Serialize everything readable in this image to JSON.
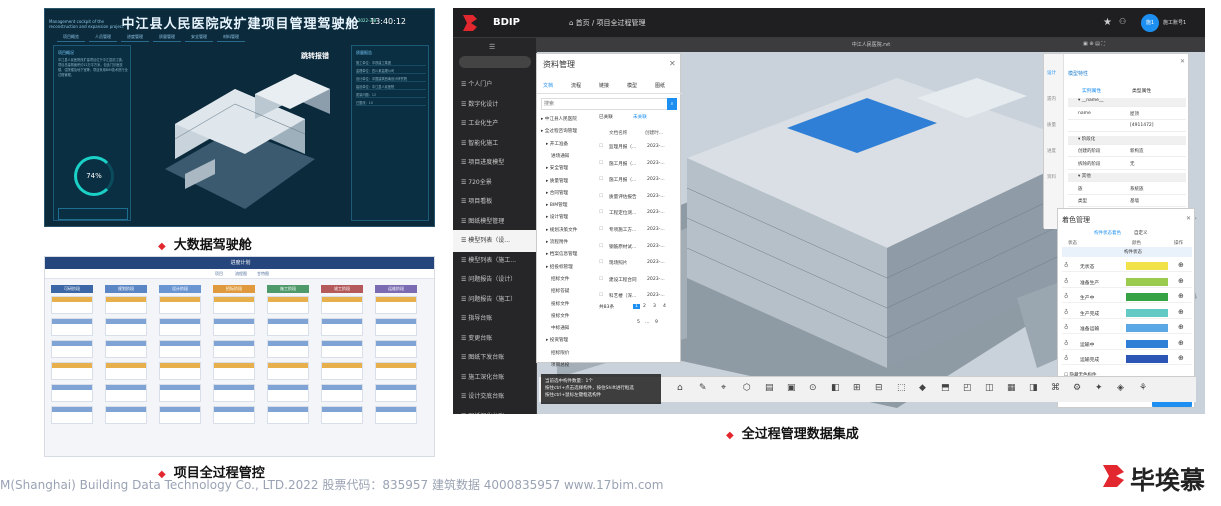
{
  "dashboard": {
    "title": "中江县人民医院改扩建项目管理驾驶舱",
    "subtitle": "Management cockpit of the reconstruction and expansion project",
    "time": "13:40:12",
    "date": "2022-3-8",
    "nav": [
      "项目概览",
      "人员管理",
      "进度管理",
      "质量管理",
      "安全管理",
      "材料管理"
    ],
    "left_head": "项目概况",
    "left_text": "中江县人民医院改扩建项目位于中江县凯江镇，项目总建筑面积约12万平方米，包含门诊医技楼、住院楼及地下室等，项目采用BIM技术进行全过程管理。",
    "gauge_value": "74%",
    "popup": "跳转报错",
    "right_head": "质量报告",
    "right_lines": [
      "施工单位：中铁建工集团",
      "监理单位：四川某监理公司",
      "设计单位：中国建筑西南设计研究院",
      "建设单位：中江县人民医院",
      "质量问题：12",
      "已整改：10"
    ]
  },
  "kanban": {
    "title": "进度计划",
    "tabs": [
      "项目",
      "流程图",
      "甘特图"
    ],
    "columns": [
      "可研阶段",
      "规划阶段",
      "设计阶段",
      "招标阶段",
      "施工阶段",
      "竣工阶段",
      "运维阶段"
    ]
  },
  "bdip": {
    "brand": "BDIP",
    "breadcrumb": "首页 / 项目全过程管理",
    "user": "施工账号1",
    "avatar": "施1",
    "viewer_title": "中江人民医院.rvt",
    "sidebar": [
      "个人门户",
      "数字化设计",
      "工业化生产",
      "智能化施工",
      "项目进度模型",
      "720全景",
      "项目看板",
      "图纸模型管理",
      "模型列表（设...",
      "模型列表（施工...",
      "问题报告（设计）",
      "问题报告（施工）",
      "指导台账",
      "变更台账",
      "图纸下发台账",
      "施工深化台账",
      "设计交底台账",
      "图纸深化台账"
    ],
    "docs": {
      "title": "资料管理",
      "tabs": [
        "文档",
        "流程",
        "链接",
        "模型",
        "图纸"
      ],
      "search_placeholder": "搜索",
      "tree": [
        "中江县人民医院",
        "全过程咨询管理",
        "开工准备",
        "进场通知",
        "安全管理",
        "质量管理",
        "合同管理",
        "BIM管理",
        "设计管理",
        "规划决策文件",
        "流程附件",
        "档案信息管理",
        "招投标管理",
        "招标文件",
        "招标答疑",
        "投标文件",
        "投标文件",
        "中标通知",
        "投资管理",
        "招标限价",
        "项目总投"
      ],
      "linked_tabs": [
        "已关联",
        "未关联"
      ],
      "headers": [
        "文档名称",
        "创建时..."
      ],
      "rows": [
        [
          "监理月报（...",
          "2023-..."
        ],
        [
          "施工月报（...",
          "2023-..."
        ],
        [
          "施工月报（...",
          "2023-..."
        ],
        [
          "质量评估报告",
          "2023-..."
        ],
        [
          "工程定位测...",
          "2023-..."
        ],
        [
          "专项施工方...",
          "2023-..."
        ],
        [
          "钢筋原材试...",
          "2023-..."
        ],
        [
          "现场照片",
          "2023-..."
        ],
        [
          "建设工程合同",
          "2023-..."
        ],
        [
          "科艺楼（深...",
          "2023-..."
        ]
      ],
      "total": "共83条",
      "pages": [
        "1",
        "2",
        "3",
        "4",
        "5",
        "…",
        "9"
      ]
    },
    "toast": [
      "当前选中构件数量：1个",
      "按住ctrl+点击选择构件，按住Shift进行框选",
      "按住ctrl+鼠标左键框选构件"
    ],
    "props": {
      "title": "模型特性",
      "tabs": [
        "实例属性",
        "类型属性"
      ],
      "side": [
        "设计",
        "遗内",
        "质量",
        "进度",
        "资料"
      ],
      "rows": [
        [
          "__name__",
          ""
        ],
        [
          "name",
          "屋顶"
        ],
        [
          "",
          "[4911472]"
        ],
        [
          "阶段化",
          ""
        ],
        [
          "创建的阶段",
          "新构造"
        ],
        [
          "拆除的阶段",
          "无"
        ],
        [
          "其他",
          ""
        ],
        [
          "族",
          "系统族"
        ],
        [
          "类型",
          "基墙"
        ],
        [
          "类型名称",
          "基础顶"
        ]
      ]
    },
    "color_mgmt": {
      "title": "着色管理",
      "tabs": [
        "构件状态着色",
        "自定义"
      ],
      "headers": [
        "状态",
        "颜色",
        "操作"
      ],
      "section": "构件状态",
      "rows": [
        {
          "label": "无状态",
          "color": "#f2e24a"
        },
        {
          "label": "准备生产",
          "color": "#9acb4f"
        },
        {
          "label": "生产中",
          "color": "#35a344"
        },
        {
          "label": "生产完成",
          "color": "#62c9c4"
        },
        {
          "label": "准备运输",
          "color": "#5aa8e6"
        },
        {
          "label": "运输中",
          "color": "#2f7fd6"
        },
        {
          "label": "运输完成",
          "color": "#2c56b5"
        }
      ],
      "options": [
        "隐藏无色构件",
        "显示模型原始色"
      ],
      "button": "分享着色模型"
    }
  },
  "captions": {
    "dashboard": "大数据驾驶舱",
    "kanban": "项目全过程管控",
    "bdip": "全过程管理数据集成"
  },
  "footer": "M(Shanghai) Building Data Technology Co., LTD.2022   股票代码：835957 建筑数据  4000835957  www.17bim.com",
  "corp": "毕埃慕",
  "accent": "#e2272f"
}
